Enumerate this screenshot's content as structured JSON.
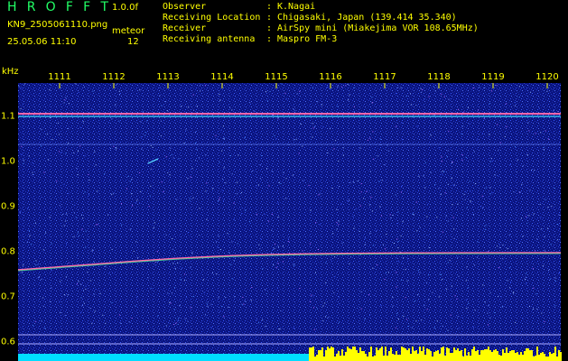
{
  "header": {
    "title_letters": [
      "H",
      "R",
      "O",
      "F",
      "F",
      "T"
    ],
    "version": "1.0.0f",
    "file_name": "KN9_2505061110.png",
    "meteor_label": "meteor",
    "date_time": "25.05.06 11:10",
    "meteor_count": "12"
  },
  "info": [
    {
      "key": "Observer",
      "value": "K.Nagai"
    },
    {
      "key": "Receiving Location",
      "value": "Chigasaki, Japan (139.414 35.340)"
    },
    {
      "key": "Receiver",
      "value": "AirSpy mini (Miakejima VOR 108.65MHz)"
    },
    {
      "key": "Receiving antenna",
      "value": "Maspro FM-3"
    }
  ],
  "axes": {
    "freq_unit": "kHz",
    "minute_labels": [
      "1111",
      "1112",
      "1113",
      "1114",
      "1115",
      "1116",
      "1117",
      "1118",
      "1119",
      "1120"
    ],
    "freq_labels": [
      "1.1",
      "1.0",
      "0.9",
      "0.8",
      "0.7",
      "0.6"
    ]
  },
  "colors": {
    "text": "#ffff00",
    "title": "#22ff66",
    "background": "#000000",
    "plot_noise": "#1a2aa8",
    "carrier_line": "#ff66aa",
    "bottom_cyan": "#00ddff",
    "bottom_yellow": "#ffff00"
  }
}
